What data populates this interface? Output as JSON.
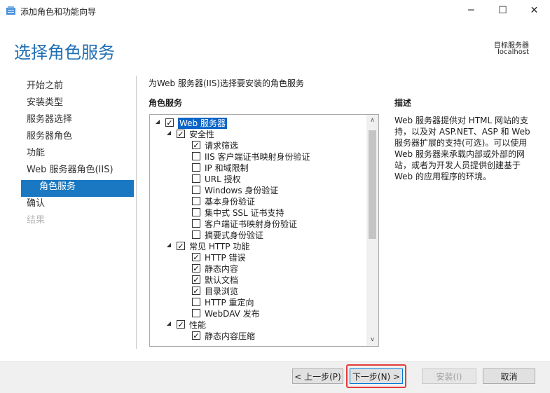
{
  "window": {
    "title": "添加角色和功能向导",
    "minimize": "─",
    "maximize": "☐",
    "close": "✕"
  },
  "header": {
    "title": "选择角色服务",
    "target_label": "目标服务器",
    "target_value": "localhost"
  },
  "nav": [
    {
      "label": "开始之前",
      "state": "normal",
      "sub": false
    },
    {
      "label": "安装类型",
      "state": "normal",
      "sub": false
    },
    {
      "label": "服务器选择",
      "state": "normal",
      "sub": false
    },
    {
      "label": "服务器角色",
      "state": "normal",
      "sub": false
    },
    {
      "label": "功能",
      "state": "normal",
      "sub": false
    },
    {
      "label": "Web 服务器角色(IIS)",
      "state": "normal",
      "sub": false
    },
    {
      "label": "角色服务",
      "state": "active",
      "sub": true
    },
    {
      "label": "确认",
      "state": "normal",
      "sub": false
    },
    {
      "label": "结果",
      "state": "disabled",
      "sub": false
    }
  ],
  "main": {
    "instruction": "为Web 服务器(IIS)选择要安装的角色服务",
    "section_label": "角色服务"
  },
  "tree": [
    {
      "label": "Web 服务器",
      "level": 0,
      "checked": true,
      "expander": "◢",
      "selected": true
    },
    {
      "label": "安全性",
      "level": 1,
      "checked": true,
      "expander": "◢"
    },
    {
      "label": "请求筛选",
      "level": 2,
      "checked": true
    },
    {
      "label": "IIS 客户端证书映射身份验证",
      "level": 2,
      "checked": false
    },
    {
      "label": "IP 和域限制",
      "level": 2,
      "checked": false
    },
    {
      "label": "URL 授权",
      "level": 2,
      "checked": false
    },
    {
      "label": "Windows 身份验证",
      "level": 2,
      "checked": false
    },
    {
      "label": "基本身份验证",
      "level": 2,
      "checked": false
    },
    {
      "label": "集中式 SSL 证书支持",
      "level": 2,
      "checked": false
    },
    {
      "label": "客户端证书映射身份验证",
      "level": 2,
      "checked": false
    },
    {
      "label": "摘要式身份验证",
      "level": 2,
      "checked": false
    },
    {
      "label": "常见 HTTP 功能",
      "level": 1,
      "checked": true,
      "expander": "◢"
    },
    {
      "label": "HTTP 错误",
      "level": 2,
      "checked": true
    },
    {
      "label": "静态内容",
      "level": 2,
      "checked": true
    },
    {
      "label": "默认文档",
      "level": 2,
      "checked": true
    },
    {
      "label": "目录浏览",
      "level": 2,
      "checked": true
    },
    {
      "label": "HTTP 重定向",
      "level": 2,
      "checked": false
    },
    {
      "label": "WebDAV 发布",
      "level": 2,
      "checked": false
    },
    {
      "label": "性能",
      "level": 1,
      "checked": true,
      "expander": "◢"
    },
    {
      "label": "静态内容压缩",
      "level": 2,
      "checked": true
    }
  ],
  "scrollbar": {
    "up": "∧",
    "down": "∨"
  },
  "description": {
    "title": "描述",
    "body": "Web 服务器提供对 HTML 网站的支持，以及对 ASP.NET、ASP 和 Web 服务器扩展的支持(可选)。可以使用 Web 服务器来承载内部或外部的网站，或者为开发人员提供创建基于 Web 的应用程序的环境。"
  },
  "buttons": {
    "prev": "< 上一步(P)",
    "next": "下一步(N) >",
    "install": "安装(I)",
    "cancel": "取消"
  },
  "colors": {
    "accent": "#1a78c2",
    "title": "#1f6fb5",
    "highlight": "#e33b3b"
  }
}
